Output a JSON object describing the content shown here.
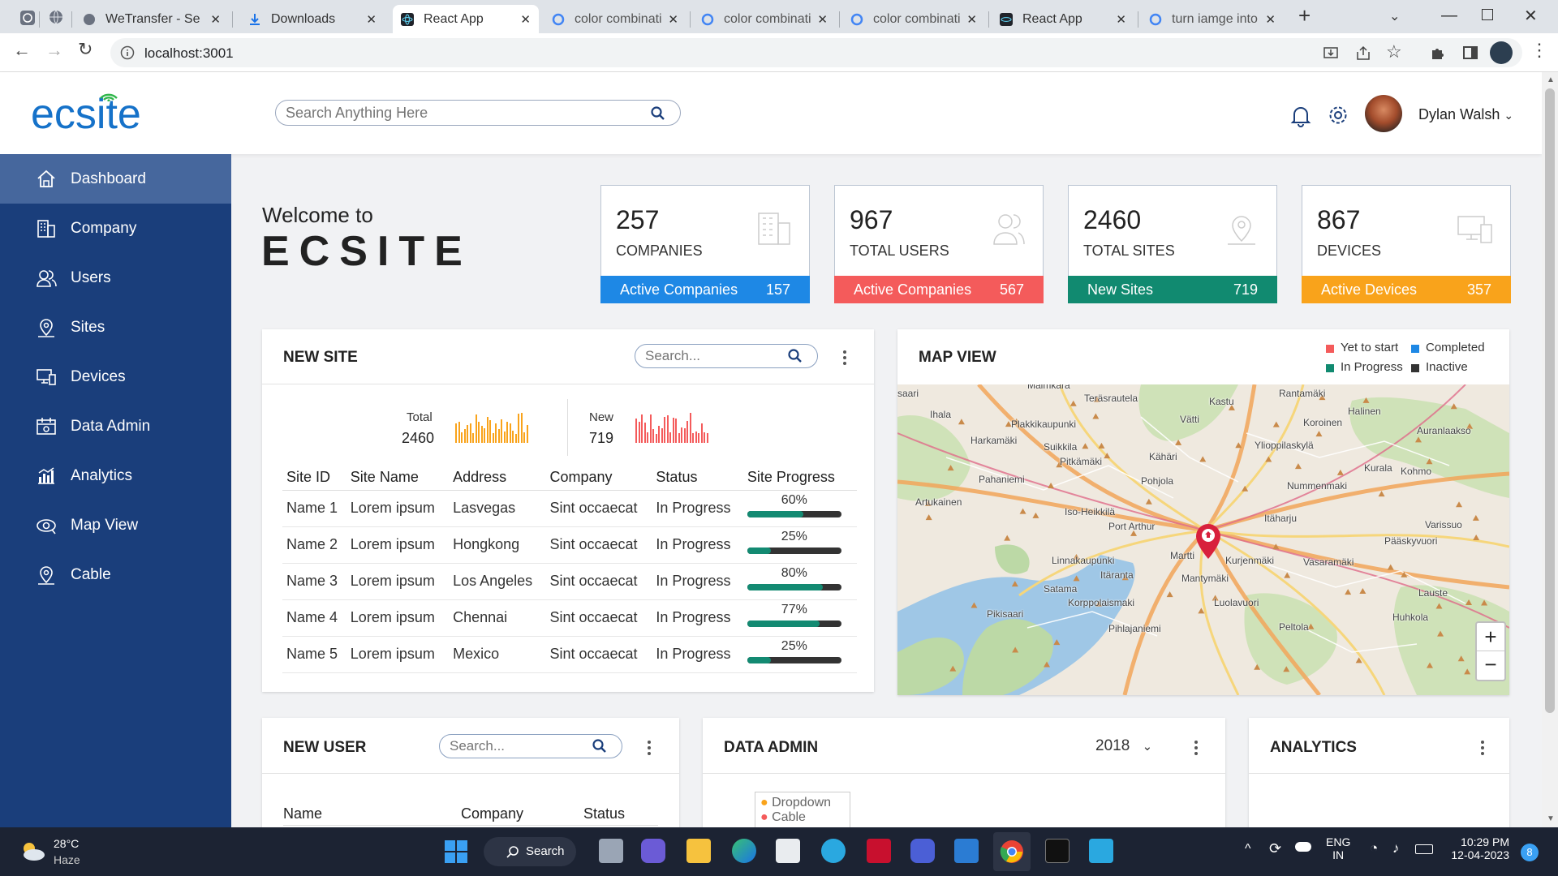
{
  "browser": {
    "tabs": [
      {
        "title": "",
        "icon": "chatgpt-icon"
      },
      {
        "title": "",
        "icon": "globe-icon"
      },
      {
        "title": "WeTransfer - Se",
        "icon": "globe-icon"
      },
      {
        "title": "Downloads",
        "icon": "download-icon"
      },
      {
        "title": "React App",
        "icon": "react-icon"
      },
      {
        "title": "color combinati",
        "icon": "google-icon"
      },
      {
        "title": "color combinati",
        "icon": "google-icon"
      },
      {
        "title": "color combinati",
        "icon": "google-icon"
      },
      {
        "title": "React App",
        "icon": "react-icon"
      },
      {
        "title": "turn iamge into",
        "icon": "google-icon"
      }
    ],
    "url": "localhost:3001"
  },
  "header": {
    "logo": "ecsite",
    "search_placeholder": "Search Anything Here",
    "user_name": "Dylan Walsh"
  },
  "sidebar": {
    "items": [
      {
        "label": "Dashboard"
      },
      {
        "label": "Company"
      },
      {
        "label": "Users"
      },
      {
        "label": "Sites"
      },
      {
        "label": "Devices"
      },
      {
        "label": "Data Admin"
      },
      {
        "label": "Analytics"
      },
      {
        "label": "Map View"
      },
      {
        "label": "Cable"
      }
    ]
  },
  "welcome": {
    "line1": "Welcome to",
    "line2": "ECSITE"
  },
  "stats": [
    {
      "value": "257",
      "label": "COMPANIES",
      "foot_label": "Active Companies",
      "foot_value": "157",
      "color": "#1e88e5"
    },
    {
      "value": "967",
      "label": "TOTAL USERS",
      "foot_label": "Active Companies",
      "foot_value": "567",
      "color": "#f45b5b"
    },
    {
      "value": "2460",
      "label": "TOTAL SITES",
      "foot_label": "New Sites",
      "foot_value": "719",
      "color": "#118a70"
    },
    {
      "value": "867",
      "label": "DEVICES",
      "foot_label": "Active Devices",
      "foot_value": "357",
      "color": "#f9a31b"
    }
  ],
  "new_site": {
    "title": "NEW SITE",
    "search_placeholder": "Search...",
    "total_label": "Total",
    "total_value": "2460",
    "new_label": "New",
    "new_value": "719",
    "columns": [
      "Site ID",
      "Site Name",
      "Address",
      "Company",
      "Status",
      "Site Progress"
    ],
    "rows": [
      {
        "id": "Name 1",
        "name": "Lorem ipsum",
        "address": "Lasvegas",
        "company": "Sint occaecat",
        "status": "In Progress",
        "progress": "60%",
        "fraction": 0.6
      },
      {
        "id": "Name 2",
        "name": "Lorem ipsum",
        "address": "Hongkong",
        "company": "Sint occaecat",
        "status": "In Progress",
        "progress": "25%",
        "fraction": 0.25
      },
      {
        "id": "Name 3",
        "name": "Lorem ipsum",
        "address": "Los Angeles",
        "company": "Sint occaecat",
        "status": "In Progress",
        "progress": "80%",
        "fraction": 0.8
      },
      {
        "id": "Name 4",
        "name": "Lorem ipsum",
        "address": "Chennai",
        "company": "Sint occaecat",
        "status": "In Progress",
        "progress": "77%",
        "fraction": 0.77
      },
      {
        "id": "Name 5",
        "name": "Lorem ipsum",
        "address": "Mexico",
        "company": "Sint occaecat",
        "status": "In Progress",
        "progress": "25%",
        "fraction": 0.25
      }
    ]
  },
  "map": {
    "title": "MAP VIEW",
    "legend": [
      {
        "label": "Yet to start",
        "color": "#f45b5b"
      },
      {
        "label": "Completed",
        "color": "#1e88e5"
      },
      {
        "label": "In Progress",
        "color": "#118a70"
      },
      {
        "label": "Inactive",
        "color": "#333333"
      }
    ],
    "places": [
      "Malmkara",
      "Teräsrautela",
      "Kastu",
      "Rantamäki",
      "Halinen",
      "Ihala",
      "Vätti",
      "Koroinen",
      "Auranlaakso",
      "Plakkikaupunki",
      "Harkamäki",
      "Suikkila",
      "Ylioppilaskylä",
      "Pitkämäki",
      "Kähäri",
      "Kurala",
      "Kohmo",
      "Pahaniemi",
      "Pohjola",
      "Nummenmaki",
      "Artukainen",
      "Iso-Heikkilä",
      "Itäharju",
      "Varissuo",
      "Port Arthur",
      "Pääskyvuori",
      "Martti",
      "Linnakaupunki",
      "Kurjenmäki",
      "Vasaramäki",
      "Itäranta",
      "Mantymäki",
      "Satama",
      "Lauste",
      "Korppolaismaki",
      "Luolavuori",
      "Pikisaari",
      "Huhkola",
      "Pihlajaniemi",
      "Peltola",
      "saari"
    ],
    "zoom_in": "+",
    "zoom_out": "−"
  },
  "new_user": {
    "title": "NEW USER",
    "search_placeholder": "Search...",
    "columns": [
      "Name",
      "Company",
      "Status"
    ]
  },
  "data_admin": {
    "title": "DATA ADMIN",
    "year": "2018",
    "legend": [
      "Dropdown",
      "Cable"
    ]
  },
  "analytics": {
    "title": "ANALYTICS"
  },
  "taskbar": {
    "temp": "28°C",
    "weather": "Haze",
    "search": "Search",
    "lang1": "ENG",
    "lang2": "IN",
    "time": "10:29 PM",
    "date": "12-04-2023",
    "badge": "8"
  }
}
